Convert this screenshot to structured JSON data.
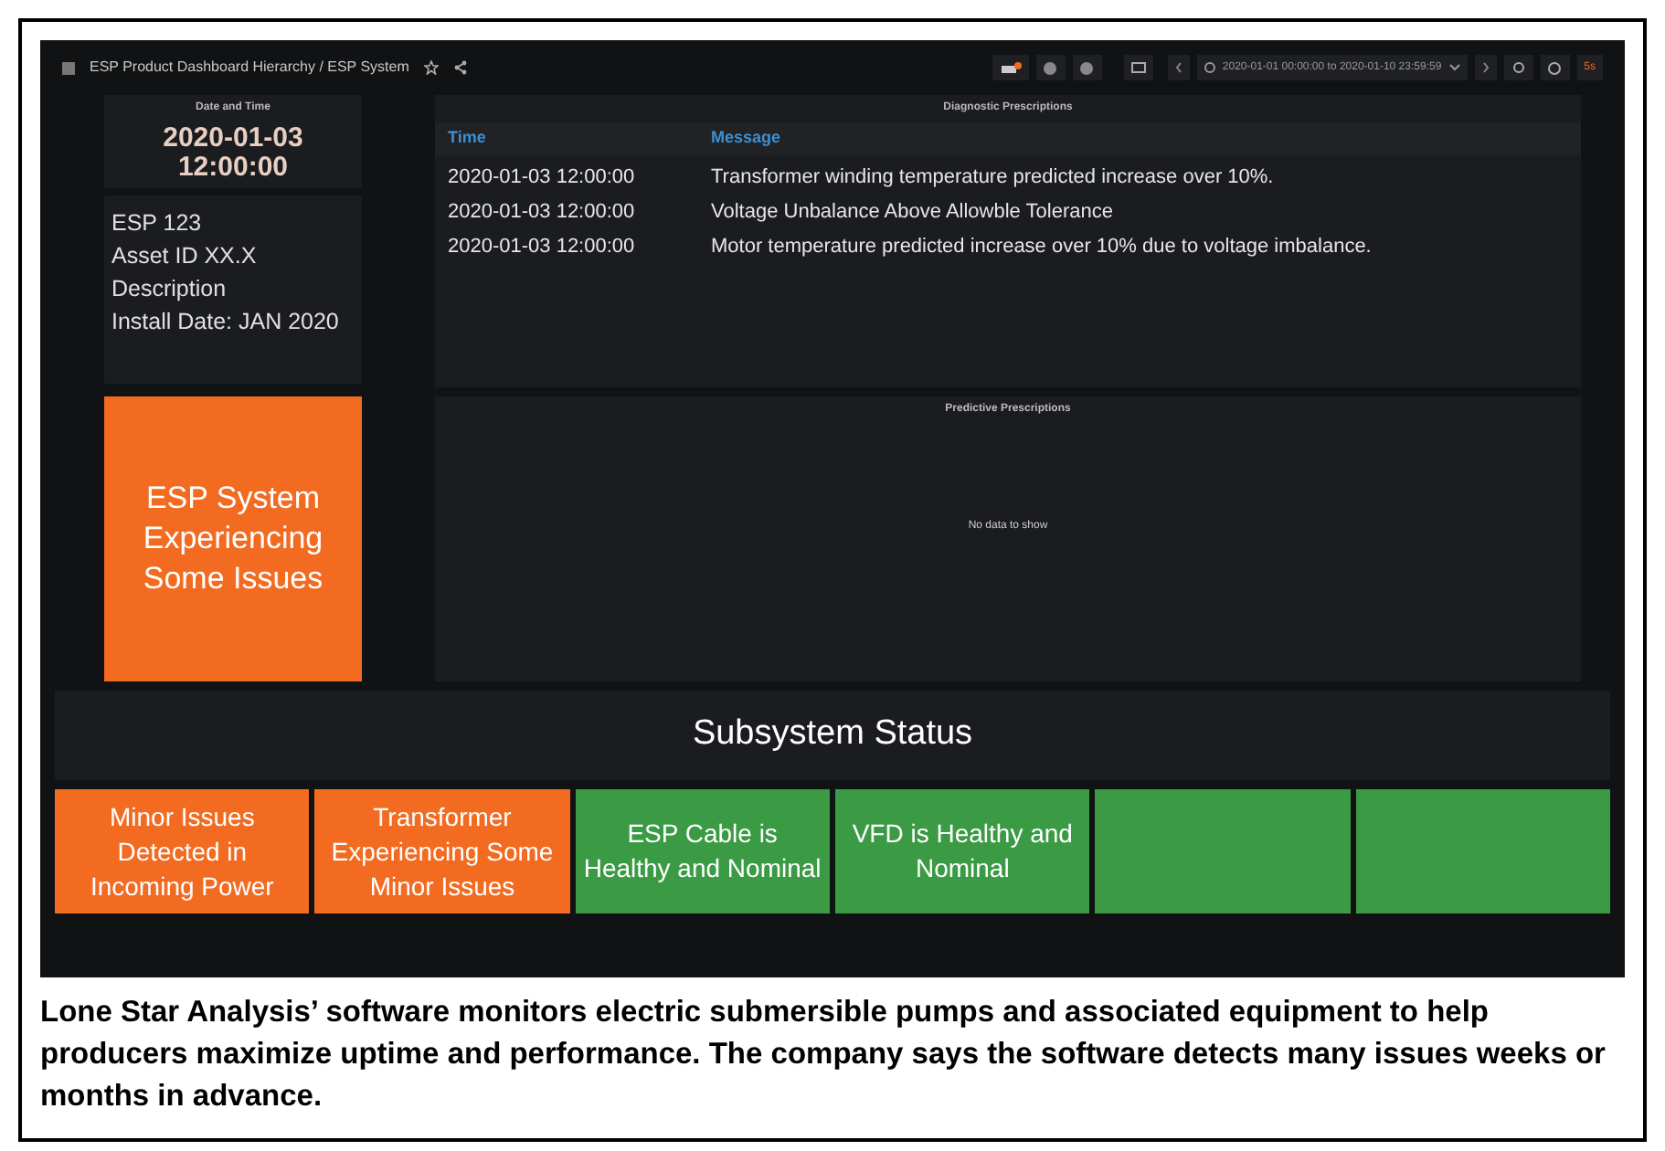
{
  "breadcrumb": "ESP Product Dashboard Hierarchy / ESP System",
  "time_range": "2020-01-01 00:00:00 to 2020-01-10 23:59:59",
  "refresh_interval": "5s",
  "date_panel": {
    "title": "Date and Time",
    "value": "2020-01-03 12:00:00"
  },
  "info_panel": {
    "lines": [
      "ESP 123",
      "Asset ID XX.X",
      "Description",
      "Install Date: JAN 2020"
    ]
  },
  "system_status": {
    "text": "ESP System Experiencing Some Issues",
    "color": "#f26b21"
  },
  "diagnostic": {
    "title": "Diagnostic Prescriptions",
    "columns": [
      "Time",
      "Message"
    ],
    "rows": [
      [
        "2020-01-03 12:00:00",
        "Transformer winding temperature predicted increase over 10%."
      ],
      [
        "2020-01-03 12:00:00",
        "Voltage Unbalance Above Allowble Tolerance"
      ],
      [
        "2020-01-03 12:00:00",
        "Motor temperature predicted increase over 10% due to voltage imbalance."
      ]
    ]
  },
  "predictive": {
    "title": "Predictive Prescriptions",
    "empty_text": "No data to show"
  },
  "subsystem_title": "Subsystem Status",
  "tiles": [
    {
      "text": "Minor Issues Detected in Incoming Power",
      "color": "#f26b21"
    },
    {
      "text": "Transformer Experiencing Some Minor Issues",
      "color": "#f26b21"
    },
    {
      "text": "ESP Cable is Healthy and Nominal",
      "color": "#3b9a44"
    },
    {
      "text": "VFD is Healthy and Nominal",
      "color": "#3b9a44"
    },
    {
      "color": "#3b9a44"
    },
    {
      "color": "#3b9a44"
    }
  ],
  "caption": "Lone Star Analysis’ software monitors electric submersible pumps and associated equipment to help producers maximize uptime and performance. The company says the software detects many issues weeks or months in advance."
}
